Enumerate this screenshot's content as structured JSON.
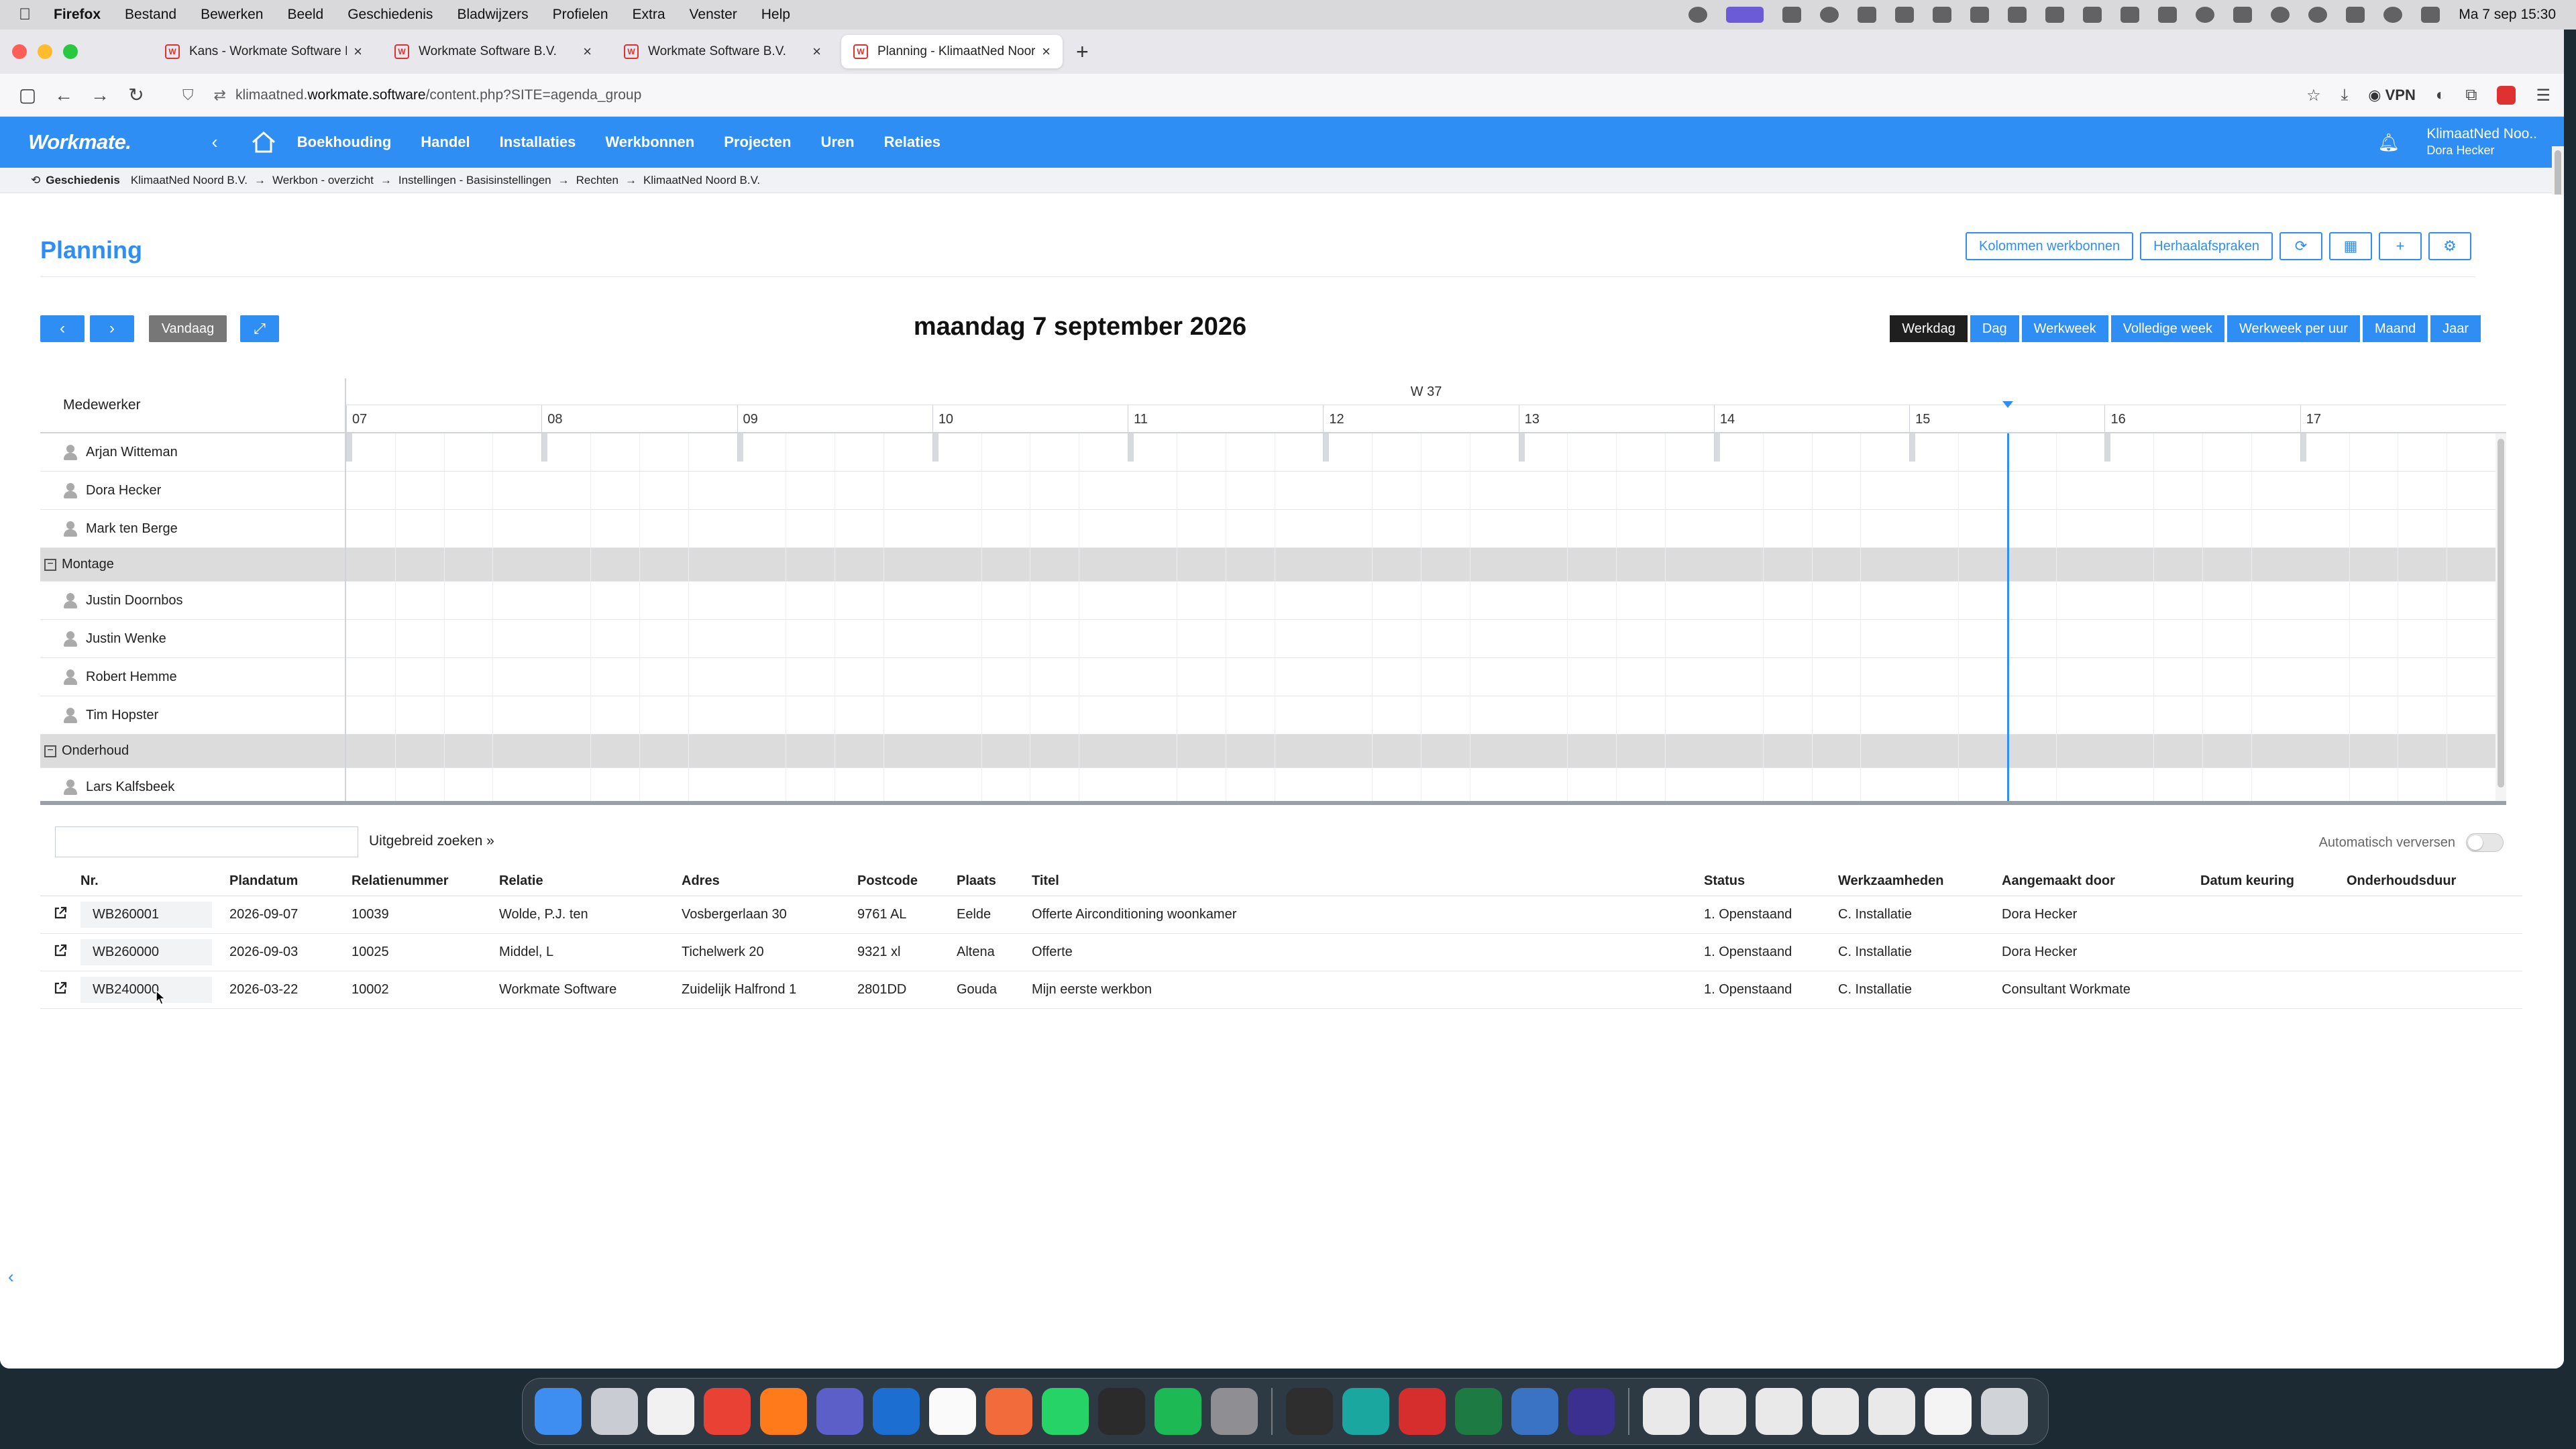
{
  "menubar": {
    "app": "Firefox",
    "items": [
      "Bestand",
      "Bewerken",
      "Beeld",
      "Geschiedenis",
      "Bladwijzers",
      "Profielen",
      "Extra",
      "Venster",
      "Help"
    ],
    "clock": "Ma 7 sep  15:30"
  },
  "browser": {
    "tabs": [
      {
        "label": "Kans - Workmate Software B.V."
      },
      {
        "label": "Workmate Software B.V."
      },
      {
        "label": "Workmate Software B.V."
      },
      {
        "label": "Planning - KlimaatNed Noord B.V."
      }
    ],
    "url_prefix": "klimaatned.",
    "url_domain": "workmate.software",
    "url_path": "/content.php?SITE=agenda_group",
    "vpn_label": "VPN"
  },
  "app": {
    "logo": "Workmate.",
    "nav": [
      "Boekhouding",
      "Handel",
      "Installaties",
      "Werkbonnen",
      "Projecten",
      "Uren",
      "Relaties"
    ],
    "company": "KlimaatNed Noo..",
    "user": "Dora Hecker"
  },
  "breadcrumb": {
    "title": "Geschiedenis",
    "items": [
      "KlimaatNed Noord B.V.",
      "Werkbon - overzicht",
      "Instellingen - Basisinstellingen",
      "Rechten",
      "KlimaatNed Noord B.V."
    ]
  },
  "page": {
    "title": "Planning",
    "tool_buttons": [
      "Kolommen werkbonnen",
      "Herhaalafspraken"
    ]
  },
  "calendar": {
    "today_label": "Vandaag",
    "date_title": "maandag 7 september 2026",
    "views": [
      "Werkdag",
      "Dag",
      "Werkweek",
      "Volledige week",
      "Werkweek per uur",
      "Maand",
      "Jaar"
    ],
    "active_view": "Werkdag",
    "week_label": "W 37",
    "hours": [
      "07",
      "08",
      "09",
      "10",
      "11",
      "12",
      "13",
      "14",
      "15",
      "16",
      "17"
    ],
    "now_hour": 15.5,
    "resource_header": "Medewerker",
    "rows": [
      {
        "type": "person",
        "name": "Arjan Witteman"
      },
      {
        "type": "person",
        "name": "Dora Hecker"
      },
      {
        "type": "person",
        "name": "Mark ten Berge"
      },
      {
        "type": "group",
        "name": "Montage"
      },
      {
        "type": "person",
        "name": "Justin Doornbos"
      },
      {
        "type": "person",
        "name": "Justin Wenke"
      },
      {
        "type": "person",
        "name": "Robert Hemme"
      },
      {
        "type": "person",
        "name": "Tim Hopster"
      },
      {
        "type": "group",
        "name": "Onderhoud"
      },
      {
        "type": "person",
        "name": "Lars Kalfsbeek"
      }
    ]
  },
  "search": {
    "placeholder": "",
    "advanced": "Uitgebreid zoeken »",
    "auto_refresh": "Automatisch verversen"
  },
  "table": {
    "headers": [
      "Nr.",
      "Plandatum",
      "Relatienummer",
      "Relatie",
      "Adres",
      "Postcode",
      "Plaats",
      "Titel",
      "Status",
      "Werkzaamheden",
      "Aangemaakt door",
      "Datum keuring",
      "Onderhoudsduur"
    ],
    "rows": [
      [
        "WB260001",
        "2026-09-07",
        "10039",
        "Wolde, P.J. ten",
        "Vosbergerlaan 30",
        "9761 AL",
        "Eelde",
        "Offerte Airconditioning woonkamer",
        "1. Openstaand",
        "C. Installatie",
        "Dora Hecker",
        "",
        ""
      ],
      [
        "WB260000",
        "2026-09-03",
        "10025",
        "Middel, L",
        "Tichelwerk 20",
        "9321 xl",
        "Altena",
        "Offerte",
        "1. Openstaand",
        "C. Installatie",
        "Dora Hecker",
        "",
        ""
      ],
      [
        "WB240000",
        "2026-03-22",
        "10002",
        "Workmate Software",
        "Zuidelijk Halfrond 1",
        "2801DD",
        "Gouda",
        "Mijn eerste werkbon",
        "1. Openstaand",
        "C. Installatie",
        "Consultant Workmate",
        "",
        ""
      ]
    ]
  }
}
